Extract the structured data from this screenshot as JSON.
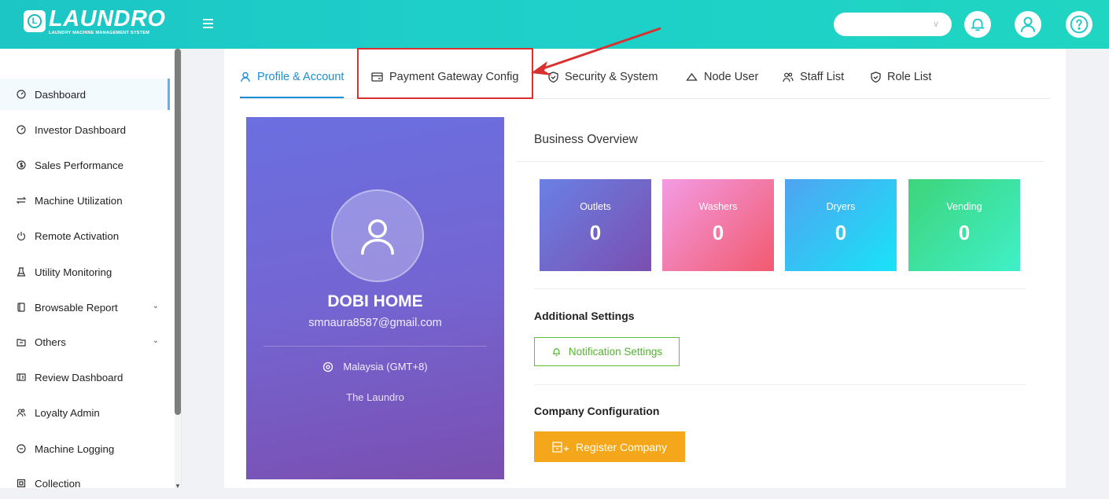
{
  "header": {
    "logo_text": "LAUNDRO",
    "logo_tagline": "LAUNDRY MACHINE MANAGEMENT SYSTEM",
    "logo_badge": "L",
    "select_value": "",
    "icons": [
      "menu-icon",
      "bell-icon",
      "user-icon",
      "help-icon"
    ]
  },
  "sidebar": {
    "items": [
      {
        "label": "Dashboard",
        "icon": "gauge-icon",
        "active": true
      },
      {
        "label": "Investor Dashboard",
        "icon": "gauge-icon"
      },
      {
        "label": "Sales Performance",
        "icon": "dollar-icon"
      },
      {
        "label": "Machine Utilization",
        "icon": "swap-icon"
      },
      {
        "label": "Remote Activation",
        "icon": "power-icon"
      },
      {
        "label": "Utility Monitoring",
        "icon": "flask-icon"
      },
      {
        "label": "Browsable Report",
        "icon": "report-icon",
        "expandable": true
      },
      {
        "label": "Others",
        "icon": "others-icon",
        "expandable": true
      },
      {
        "label": "Review Dashboard",
        "icon": "review-icon"
      },
      {
        "label": "Loyalty Admin",
        "icon": "team-icon"
      },
      {
        "label": "Machine Logging",
        "icon": "log-icon"
      },
      {
        "label": "Collection",
        "icon": "collection-icon"
      }
    ]
  },
  "tabs": [
    {
      "label": "Profile & Account",
      "icon": "user-icon",
      "active": true
    },
    {
      "label": "Payment Gateway Config",
      "icon": "card-icon"
    },
    {
      "label": "Security & System",
      "icon": "shield-icon"
    },
    {
      "label": "Node User",
      "icon": "cloud-icon"
    },
    {
      "label": "Staff List",
      "icon": "team-icon"
    },
    {
      "label": "Role List",
      "icon": "shield-icon"
    }
  ],
  "profile": {
    "name": "DOBI HOME",
    "email": "smnaura8587@gmail.com",
    "location": "Malaysia (GMT+8)",
    "company": "The Laundro"
  },
  "overview": {
    "title": "Business Overview",
    "stats": [
      {
        "label": "Outlets",
        "value": "0",
        "color_from": "#6a80e4",
        "color_to": "#7a4fb0"
      },
      {
        "label": "Washers",
        "value": "0",
        "color_from": "#f39be4",
        "color_to": "#f25a6e"
      },
      {
        "label": "Dryers",
        "value": "0",
        "color_from": "#4fa3f0",
        "color_to": "#19e3f8"
      },
      {
        "label": "Vending",
        "value": "0",
        "color_from": "#3ed47a",
        "color_to": "#3ff0c8"
      }
    ]
  },
  "additional": {
    "title": "Additional Settings",
    "notification_button": "Notification Settings"
  },
  "company": {
    "title": "Company Configuration",
    "register_button": "Register Company"
  },
  "colors": {
    "header": "#1ed0c9",
    "accent": "#1a8fd8",
    "annotation": "#d93030",
    "success": "#52b52e",
    "warning": "#f4a71a"
  }
}
